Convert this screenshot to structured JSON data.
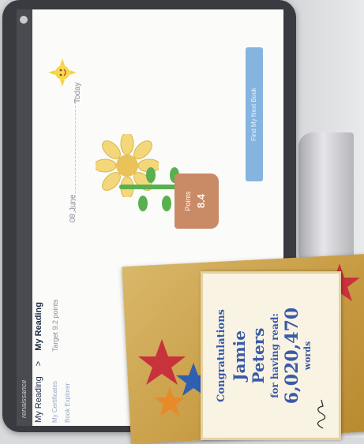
{
  "app": {
    "breadcrumb_root": "My Reading",
    "breadcrumb_sep": ">",
    "breadcrumb_current": "My Reading",
    "sub_link_1": "My Certificates",
    "sub_link_2": "Book Explorer",
    "target_text": "Target 9.2 points",
    "date_start": "08 June",
    "date_end": "Today",
    "points_label": "Points",
    "points_value": "8.4",
    "find_button": "Find My Next Book"
  },
  "certificate": {
    "line1": "Congratulations",
    "line2": "Jamie",
    "line3": "Peters",
    "line4": "for having read:",
    "line5": "6,020,470",
    "line6": "words"
  },
  "colors": {
    "accent_blue": "#86b4e0",
    "cert_text": "#3a5aa6",
    "pot": "#c98a66",
    "leaf": "#58b04f"
  }
}
